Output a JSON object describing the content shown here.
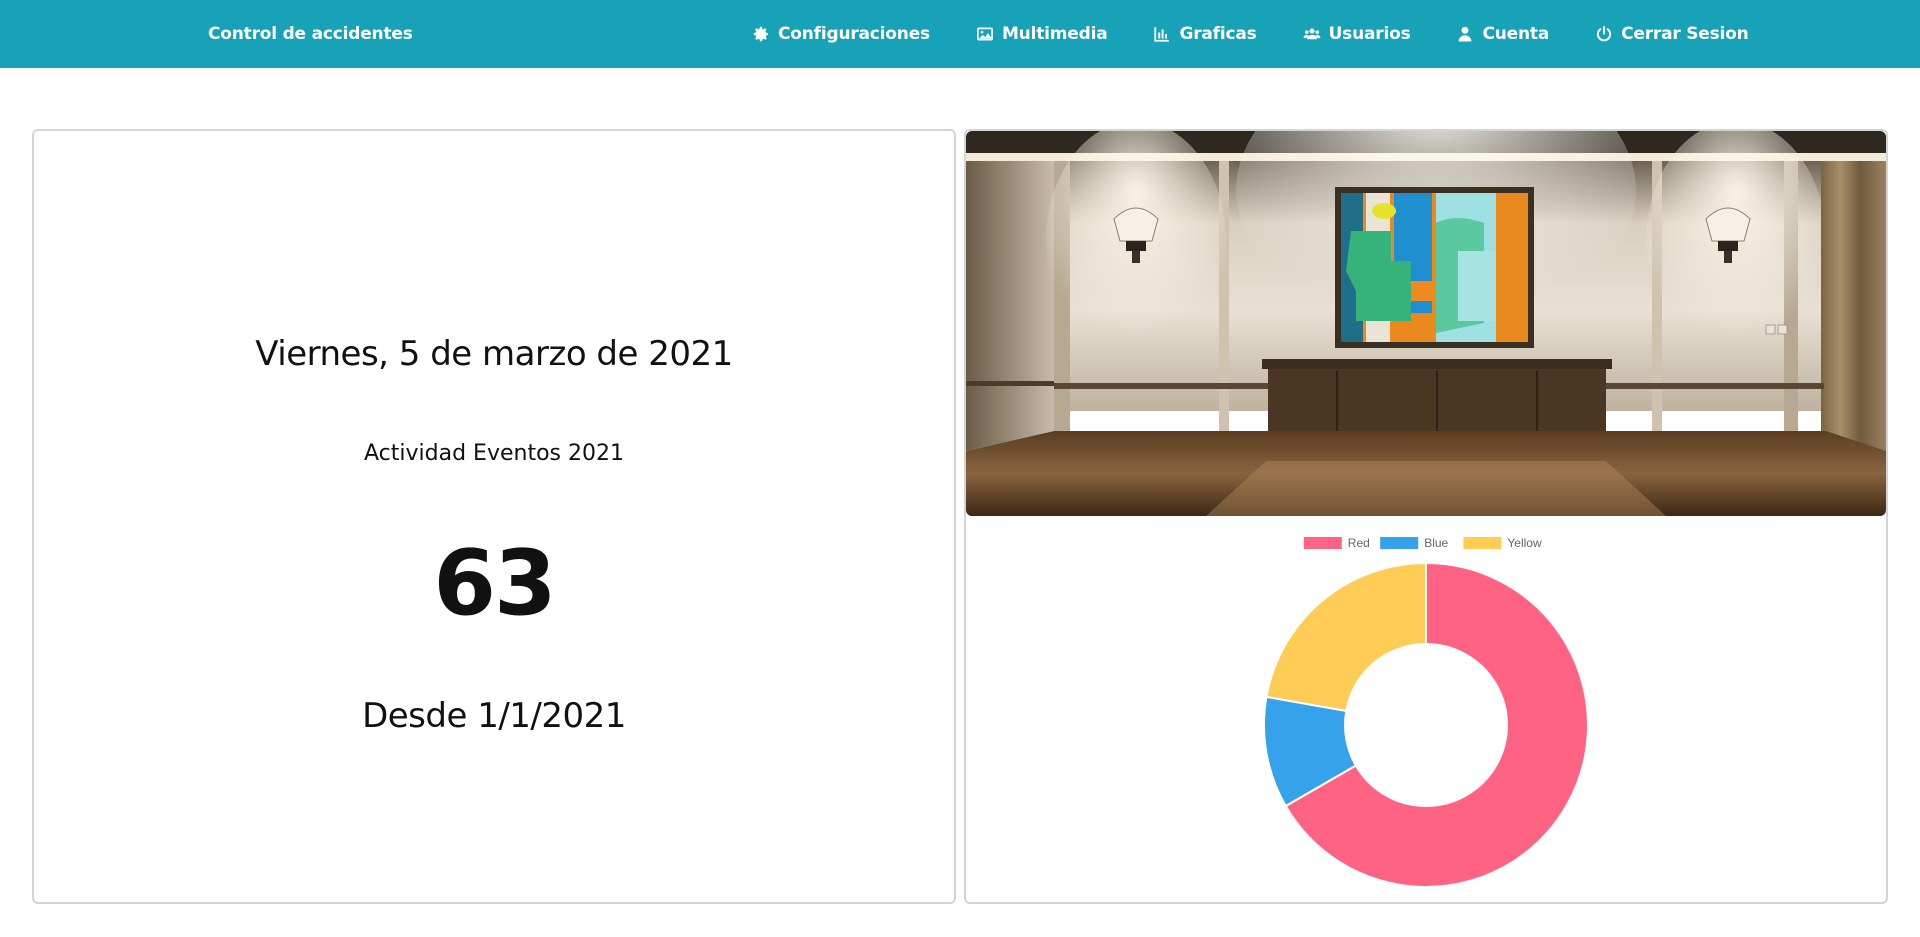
{
  "navbar": {
    "brand": "Control de accidentes",
    "background": "#17a2b8",
    "items": [
      {
        "label": "Configuraciones",
        "icon": "gear-icon"
      },
      {
        "label": "Multimedia",
        "icon": "image-icon"
      },
      {
        "label": "Graficas",
        "icon": "bar-chart-icon"
      },
      {
        "label": "Usuarios",
        "icon": "users-icon"
      },
      {
        "label": "Cuenta",
        "icon": "user-icon"
      },
      {
        "label": "Cerrar Sesion",
        "icon": "power-icon"
      }
    ]
  },
  "summary": {
    "date": "Viernes, 5 de marzo de 2021",
    "activity_label": "Actividad Eventos 2021",
    "count": "63",
    "since": "Desde 1/1/2021"
  },
  "chart_data": {
    "type": "pie",
    "variant": "doughnut",
    "categories": [
      "Red",
      "Blue",
      "Yellow"
    ],
    "values": [
      300,
      50,
      100
    ],
    "colors": [
      "#ff6384",
      "#36a2eb",
      "#ffcd56"
    ],
    "legend": "top",
    "title": ""
  }
}
